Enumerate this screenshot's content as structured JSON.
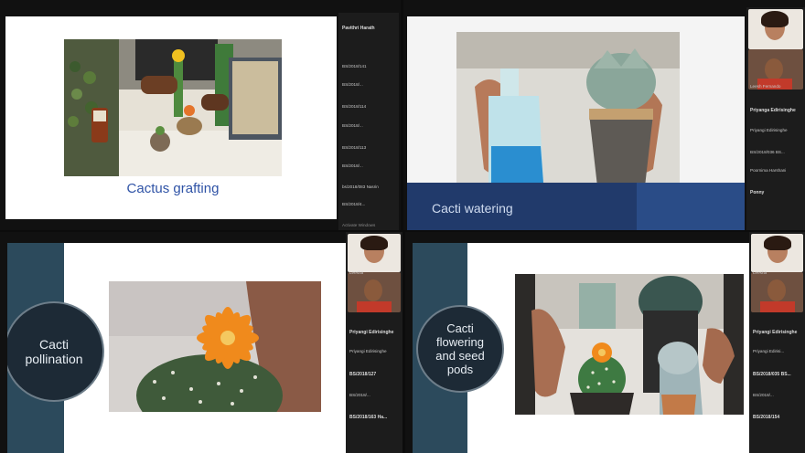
{
  "panels": [
    {
      "caption": "Cactus grafting",
      "sidebar": [
        "Pavithri Harath",
        "BS/2018/141",
        "BS/2018/...",
        "BS/2018/114",
        "BS/2018/...",
        "BS/2018/113",
        "BS/2018/...",
        "bs/2018/083 Nasrin",
        "BS/2018/4..."
      ],
      "watermark": "Activate Windows"
    },
    {
      "caption": "Cacti watering",
      "sidebar": [
        "Leesh Fernando",
        "Priyanga Edirisinghe",
        "Priyangi Edirisinghe",
        "BS/2018/036 BS...",
        "Poornima Harshani",
        "Ponny"
      ]
    },
    {
      "caption_line1": "Cacti",
      "caption_line2": "pollination",
      "sidebar": [
        "Leesha",
        "Priyangi Edirisinghe",
        "Priyangi Edirisinghe",
        "BS/2018/127",
        "BS/2018/...",
        "BS/2018/163 Ha..."
      ]
    },
    {
      "caption_line1": "Cacti",
      "caption_line2": "flowering",
      "caption_line3": "and seed",
      "caption_line4": "pods",
      "sidebar": [
        "Leesha",
        "Priyangi Edirisinghe",
        "Priyangi Edirisi...",
        "BS/2018/035 BS...",
        "BS/2018/...",
        "BS/2018/154"
      ]
    }
  ]
}
